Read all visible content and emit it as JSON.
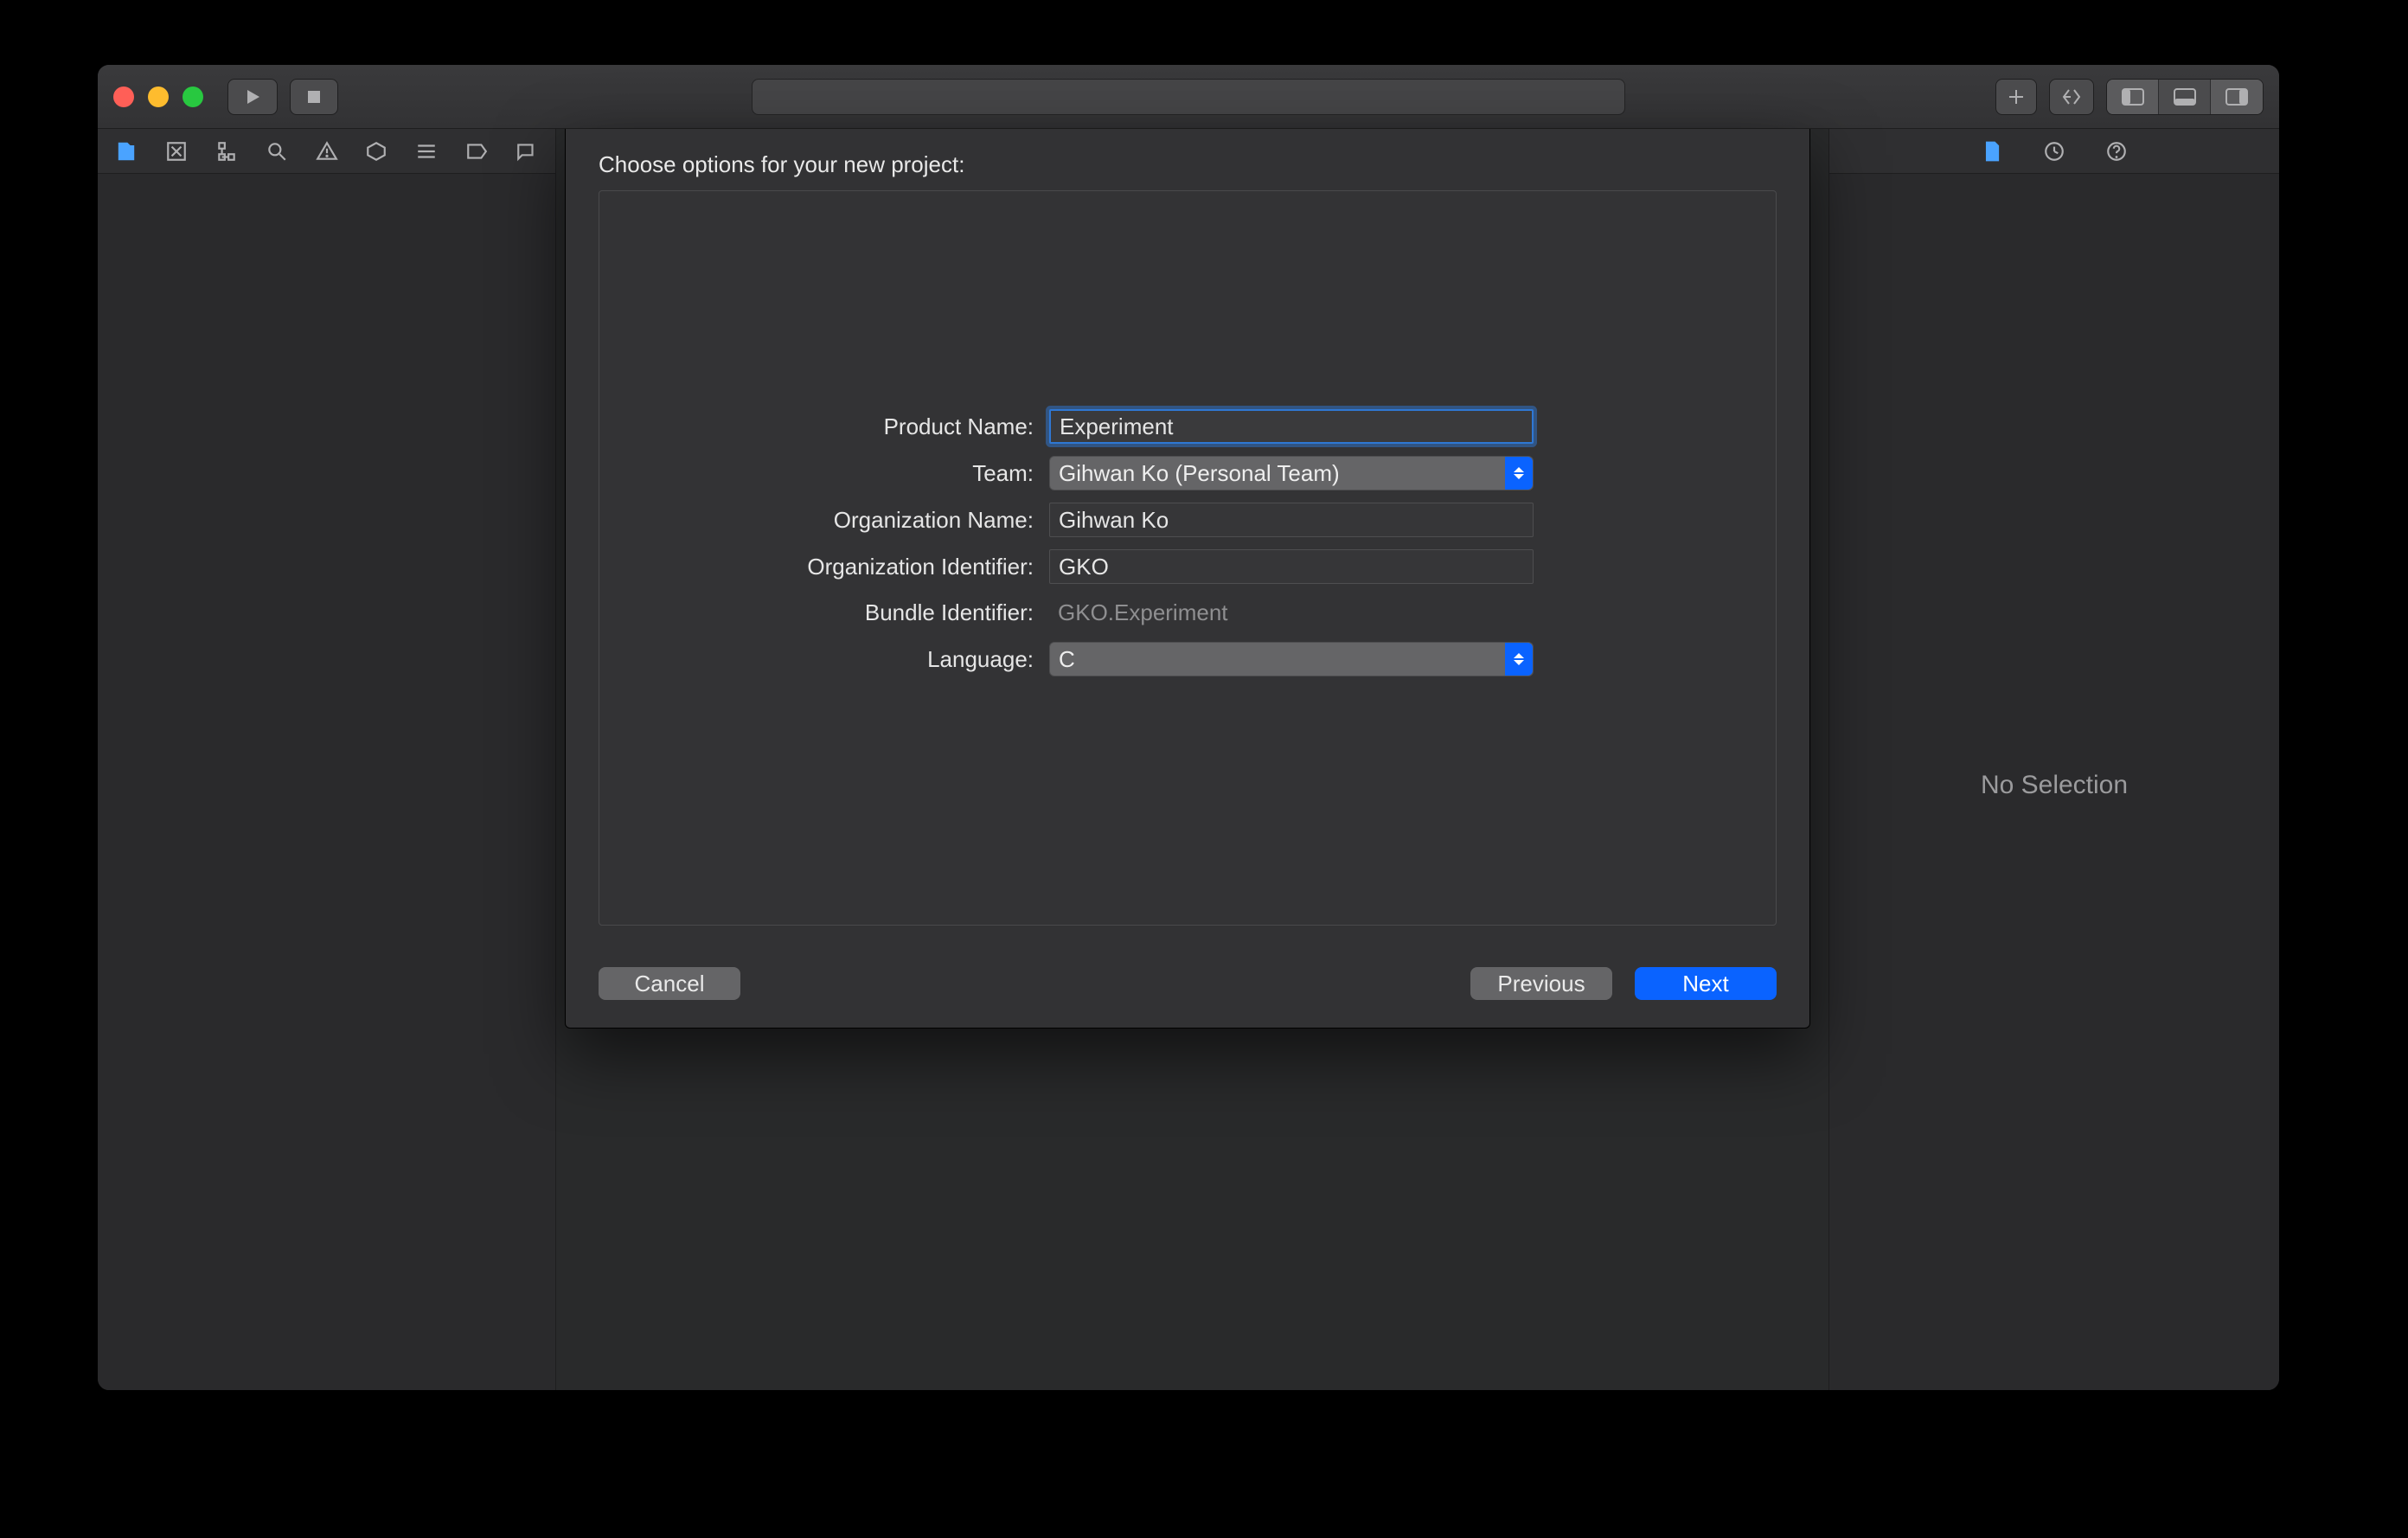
{
  "inspector": {
    "no_selection": "No Selection"
  },
  "sheet": {
    "title": "Choose options for your new project:",
    "labels": {
      "product_name": "Product Name:",
      "team": "Team:",
      "org_name": "Organization Name:",
      "org_id": "Organization Identifier:",
      "bundle_id": "Bundle Identifier:",
      "language": "Language:"
    },
    "values": {
      "product_name": "Experiment",
      "team": "Gihwan Ko (Personal Team)",
      "org_name": "Gihwan Ko",
      "org_id": "GKO",
      "bundle_id": "GKO.Experiment",
      "language": "C"
    },
    "buttons": {
      "cancel": "Cancel",
      "previous": "Previous",
      "next": "Next"
    }
  }
}
